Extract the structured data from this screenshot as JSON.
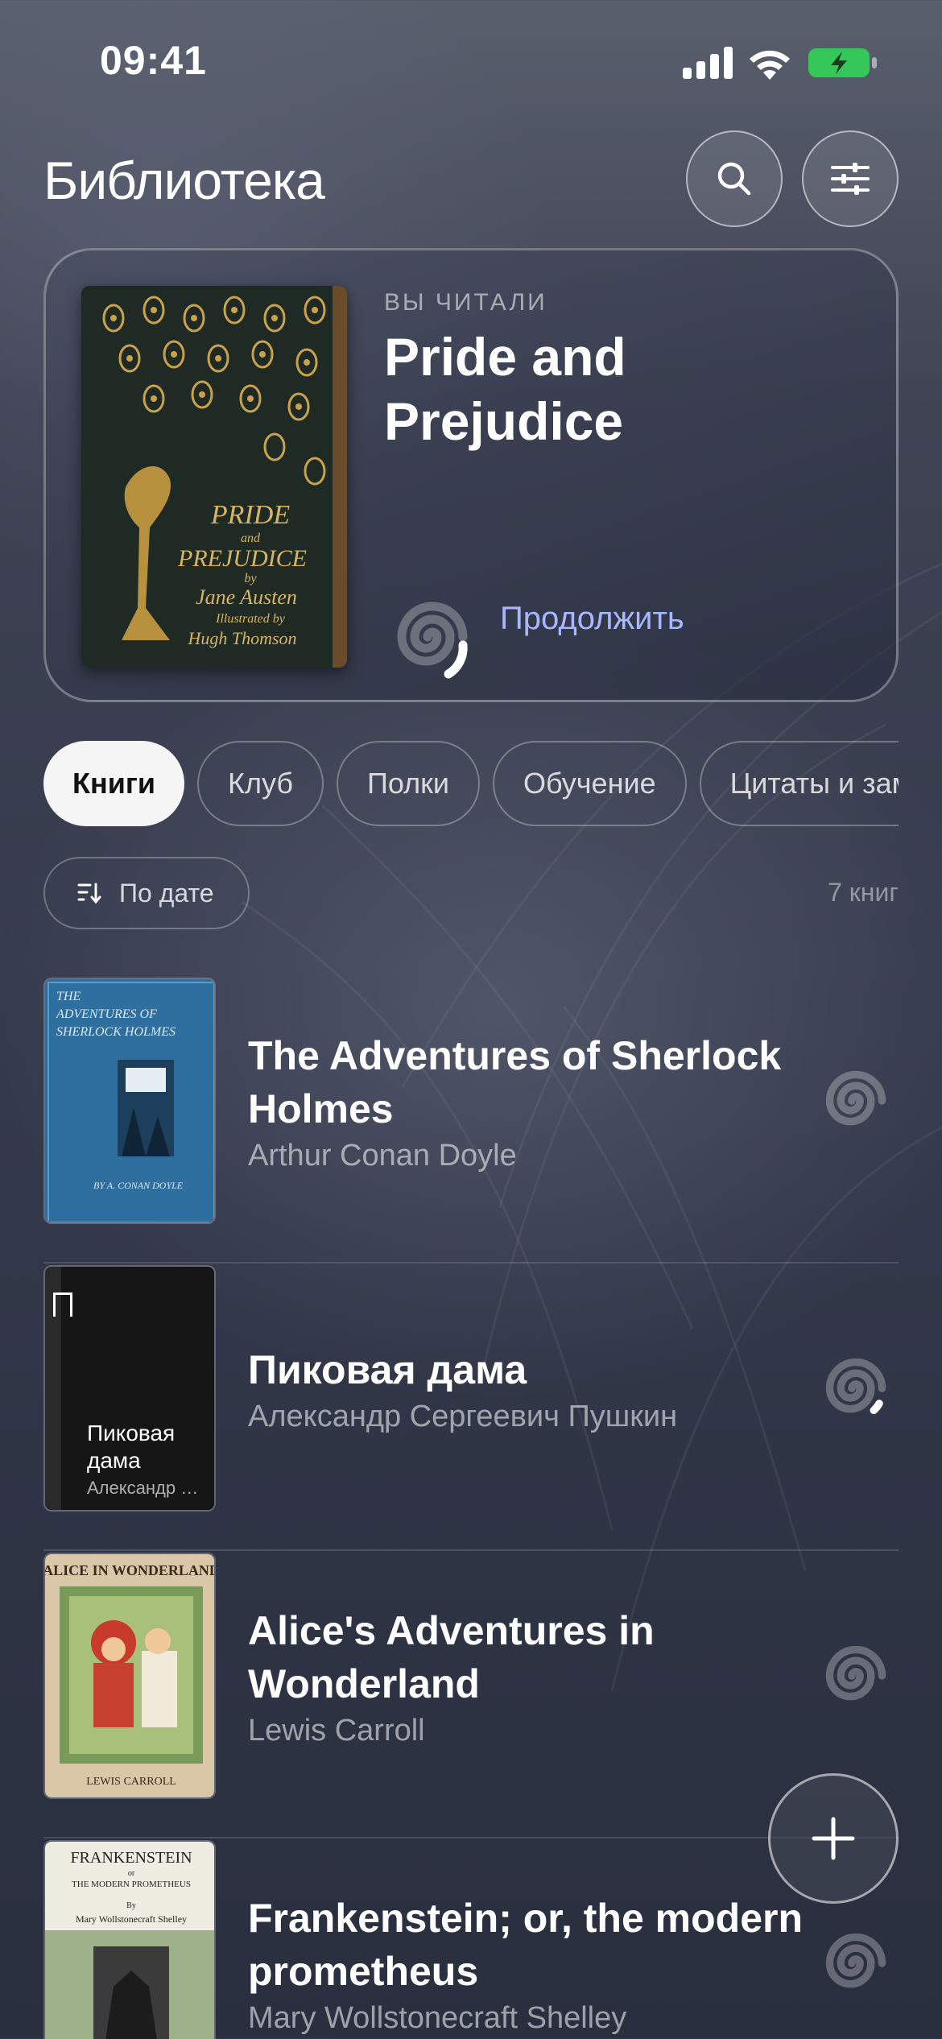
{
  "status_bar": {
    "time": "09:41"
  },
  "header": {
    "title": "Библиотека"
  },
  "continue_card": {
    "overline": "ВЫ ЧИТАЛИ",
    "title": "Pride and Prejudice",
    "cover_text": [
      "PRIDE",
      "and",
      "PREJUDICE",
      "by",
      "Jane Austen",
      "Illustrated by",
      "Hugh Thomson"
    ],
    "progress": 0.06,
    "continue_label": "Продолжить"
  },
  "tabs": [
    {
      "label": "Книги",
      "active": true
    },
    {
      "label": "Клуб",
      "active": false
    },
    {
      "label": "Полки",
      "active": false
    },
    {
      "label": "Обучение",
      "active": false
    },
    {
      "label": "Цитаты и заметки",
      "active": false
    }
  ],
  "sort": {
    "label": "По дате",
    "count": "7 книг"
  },
  "books": [
    {
      "title": "The Adventures of Sherlock Holmes",
      "author": "Arthur Conan Doyle",
      "cover_text": [
        "THE",
        "ADVENTURES OF",
        "SHERLOCK HOLMES",
        "BY A. CONAN DOYLE"
      ],
      "progress": 0
    },
    {
      "title": "Пиковая дама",
      "author": "Александр Сергеевич Пушкин",
      "cover_title": "Пиковая дама",
      "cover_author": "Александр Сергеевич Пушкин",
      "progress": 0.03
    },
    {
      "title": "Alice's Adventures in Wonderland",
      "author": "Lewis Carroll",
      "cover_text": [
        "ALICE IN WONDERLAND",
        "LEWIS CARROLL"
      ],
      "progress": 0
    },
    {
      "title": "Frankenstein; or, the modern prometheus",
      "author": "Mary Wollstonecraft Shelley",
      "cover_text": [
        "FRANKENSTEIN",
        "or",
        "THE MODERN PROMETHEUS",
        "By",
        "Mary Wollstonecraft Shelley"
      ],
      "progress": 0
    }
  ],
  "fab": {
    "icon": "plus-icon"
  },
  "colors": {
    "accent_link": "#a8b8ff",
    "battery": "#34c759"
  }
}
